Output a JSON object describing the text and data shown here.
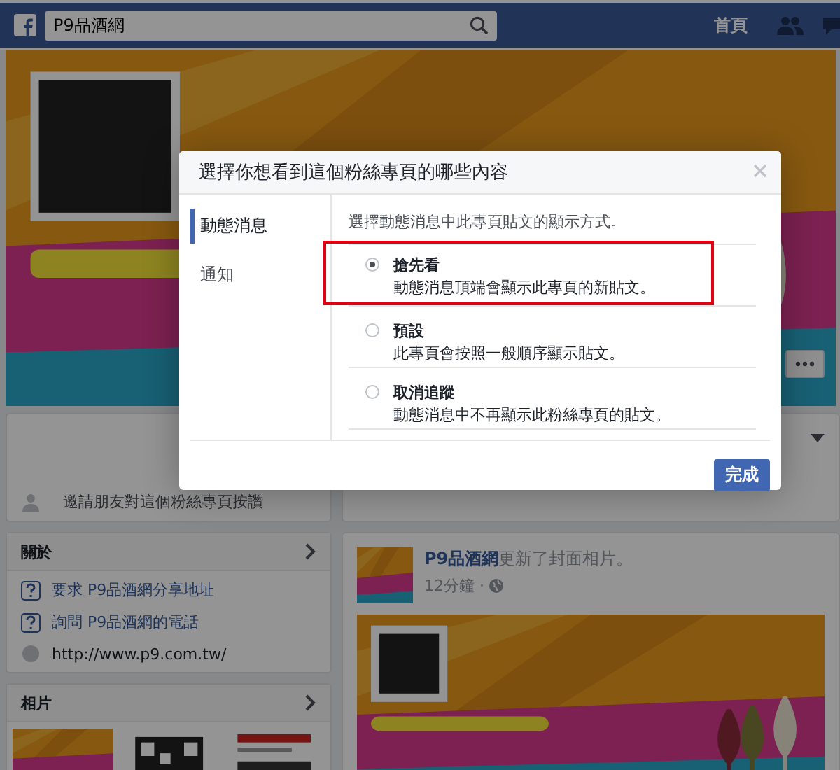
{
  "top_bar": {
    "search": {
      "value": "P9品酒網"
    },
    "nav": [
      {
        "label": "首頁"
      }
    ]
  },
  "left_column": {
    "invite": "邀請朋友對這個粉絲專頁按讚",
    "about": {
      "title": "關於",
      "items": [
        {
          "kind": "question",
          "text": "要求 P9品酒網分享地址"
        },
        {
          "kind": "question",
          "text": "詢問 P9品酒網的電話"
        },
        {
          "kind": "website",
          "text": "http://www.p9.com.tw/"
        }
      ]
    },
    "photos": {
      "title": "相片"
    }
  },
  "post": {
    "author": "P9品酒網",
    "action": "更新了封面相片。",
    "time": "12分鐘 ·"
  },
  "dialog": {
    "title": "選擇你想看到這個粉絲專頁的哪些內容",
    "tabs": [
      {
        "label": "動態消息",
        "selected": true
      },
      {
        "label": "通知",
        "selected": false
      }
    ],
    "prompt": "選擇動態消息中此專頁貼文的顯示方式。",
    "options": [
      {
        "title": "搶先看",
        "description": "動態消息頂端會顯示此專頁的新貼文。",
        "selected": true,
        "highlighted": true
      },
      {
        "title": "預設",
        "description": "此專頁會按照一般順序顯示貼文。",
        "selected": false,
        "highlighted": false
      },
      {
        "title": "取消追蹤",
        "description": "動態消息中不再顯示此粉絲專頁的貼文。",
        "selected": false,
        "highlighted": false
      }
    ],
    "done_button": "完成"
  }
}
